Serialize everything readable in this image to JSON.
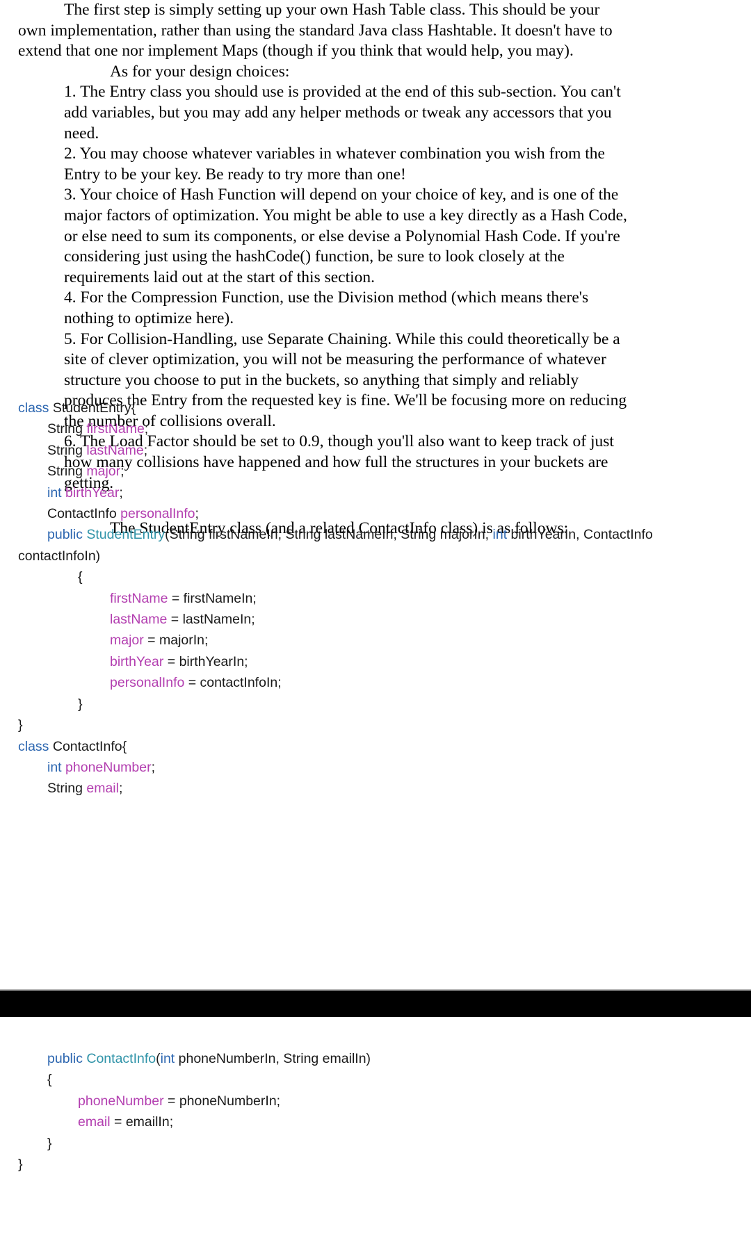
{
  "document": {
    "type": "assignment-handout",
    "colors": {
      "background": "#ffffff",
      "text": "#000000",
      "keyword": "#2c66b0",
      "class_name": "#2f93a8",
      "field_name": "#b33fb0",
      "code_plain": "#1a1a1a",
      "bar": "#000000"
    }
  },
  "prose": {
    "intro_paragraph": "The first step is simply setting up your own Hash Table class. This should be your own implementation, rather than using the standard Java class Hashtable. It doesn't have to extend that one nor implement Maps (though if you think that would help, you may).",
    "design_lead": "As for your design choices:",
    "items": [
      "1. The Entry class you should use is provided at the end of this sub-section. You can't add variables, but you may add any helper methods or tweak any accessors that you need.",
      "2. You may choose whatever variables in whatever combination you wish from the Entry to be your key. Be ready to try more than one!",
      "3. Your choice of Hash Function will depend on your choice of key, and is one of the major factors of optimization. You might be able to use a key directly as a Hash Code, or else need to sum its components, or else devise a Polynomial Hash Code. If you're considering just using the hashCode() function, be sure to look closely at the requirements laid out at the start of this section.",
      "4. For the Compression Function, use the Division method (which means there's nothing to optimize here).",
      "5. For Collision-Handling, use Separate Chaining. While this could theoretically be a site of clever optimization, you will not be measuring the performance of whatever structure you choose to put in the buckets, so anything that simply and reliably produces the Entry from the requested key is fine. We'll be focusing more on reducing the number of collisions overall.",
      "6. The Load Factor should be set to 0.9, though you'll also want to keep track of just how many collisions have happened and how full the structures in your buckets are getting."
    ],
    "code_lead": "The StudentEntry class (and a related ContactInfo class) is as follows:"
  },
  "code_top": {
    "lines": [
      {
        "indent": 0,
        "tokens": [
          {
            "t": "class",
            "c": "kw"
          },
          {
            "t": " StudentEntry{",
            "c": "plain"
          }
        ]
      },
      {
        "indent": 1,
        "tokens": [
          {
            "t": "String ",
            "c": "plain"
          },
          {
            "t": "firstName",
            "c": "field"
          },
          {
            "t": ";",
            "c": "plain"
          }
        ]
      },
      {
        "indent": 1,
        "tokens": [
          {
            "t": "String ",
            "c": "plain"
          },
          {
            "t": "lastName",
            "c": "field"
          },
          {
            "t": ";",
            "c": "plain"
          }
        ]
      },
      {
        "indent": 1,
        "tokens": [
          {
            "t": "String ",
            "c": "plain"
          },
          {
            "t": "major",
            "c": "field"
          },
          {
            "t": ";",
            "c": "plain"
          }
        ]
      },
      {
        "indent": 1,
        "tokens": [
          {
            "t": "int",
            "c": "kw"
          },
          {
            "t": " ",
            "c": "plain"
          },
          {
            "t": "birthYear",
            "c": "field"
          },
          {
            "t": ";",
            "c": "plain"
          }
        ]
      },
      {
        "indent": 1,
        "tokens": [
          {
            "t": "ContactInfo ",
            "c": "plain"
          },
          {
            "t": "personalInfo",
            "c": "field"
          },
          {
            "t": ";",
            "c": "plain"
          }
        ]
      },
      {
        "indent": 1,
        "tokens": [
          {
            "t": "public ",
            "c": "kw"
          },
          {
            "t": "StudentEntry",
            "c": "cls"
          },
          {
            "t": "(String firstNameIn, String lastNameIn, String majorIn, ",
            "c": "plain"
          },
          {
            "t": "int",
            "c": "kw"
          },
          {
            "t": " birthYearIn, ContactInfo",
            "c": "plain"
          }
        ]
      },
      {
        "indent": 0,
        "tokens": [
          {
            "t": "contactInfoIn)",
            "c": "plain"
          }
        ]
      },
      {
        "indent": 2,
        "tokens": [
          {
            "t": "{",
            "c": "plain"
          }
        ]
      },
      {
        "indent": 3,
        "tokens": [
          {
            "t": "firstName",
            "c": "field"
          },
          {
            "t": " = firstNameIn;",
            "c": "plain"
          }
        ]
      },
      {
        "indent": 3,
        "tokens": [
          {
            "t": "lastName",
            "c": "field"
          },
          {
            "t": " = lastNameIn;",
            "c": "plain"
          }
        ]
      },
      {
        "indent": 3,
        "tokens": [
          {
            "t": "major",
            "c": "field"
          },
          {
            "t": " = majorIn;",
            "c": "plain"
          }
        ]
      },
      {
        "indent": 3,
        "tokens": [
          {
            "t": "birthYear",
            "c": "field"
          },
          {
            "t": " = birthYearIn;",
            "c": "plain"
          }
        ]
      },
      {
        "indent": 3,
        "tokens": [
          {
            "t": "personalInfo",
            "c": "field"
          },
          {
            "t": " = contactInfoIn;",
            "c": "plain"
          }
        ]
      },
      {
        "indent": 2,
        "tokens": [
          {
            "t": "}",
            "c": "plain"
          }
        ]
      },
      {
        "indent": 0,
        "tokens": [
          {
            "t": "}",
            "c": "plain"
          }
        ]
      },
      {
        "indent": 0,
        "tokens": [
          {
            "t": "class",
            "c": "kw"
          },
          {
            "t": " ContactInfo{",
            "c": "plain"
          }
        ]
      },
      {
        "indent": 1,
        "tokens": [
          {
            "t": "int",
            "c": "kw"
          },
          {
            "t": " ",
            "c": "plain"
          },
          {
            "t": "phoneNumber",
            "c": "field"
          },
          {
            "t": ";",
            "c": "plain"
          }
        ]
      },
      {
        "indent": 1,
        "tokens": [
          {
            "t": "String ",
            "c": "plain"
          },
          {
            "t": "email",
            "c": "field"
          },
          {
            "t": ";",
            "c": "plain"
          }
        ]
      }
    ]
  },
  "code_bottom": {
    "lines": [
      {
        "indent": 1,
        "tokens": [
          {
            "t": "public ",
            "c": "kw"
          },
          {
            "t": "ContactInfo",
            "c": "cls"
          },
          {
            "t": "(",
            "c": "plain"
          },
          {
            "t": "int",
            "c": "kw"
          },
          {
            "t": " phoneNumberIn, String emailIn)",
            "c": "plain"
          }
        ]
      },
      {
        "indent": 1,
        "tokens": [
          {
            "t": "{",
            "c": "plain"
          }
        ]
      },
      {
        "indent": 2,
        "tokens": [
          {
            "t": "phoneNumber",
            "c": "field"
          },
          {
            "t": " = phoneNumberIn;",
            "c": "plain"
          }
        ]
      },
      {
        "indent": 2,
        "tokens": [
          {
            "t": "email",
            "c": "field"
          },
          {
            "t": " = emailIn;",
            "c": "plain"
          }
        ]
      },
      {
        "indent": 1,
        "tokens": [
          {
            "t": "}",
            "c": "plain"
          }
        ]
      },
      {
        "indent": 0,
        "tokens": [
          {
            "t": "}",
            "c": "plain"
          }
        ]
      }
    ]
  }
}
